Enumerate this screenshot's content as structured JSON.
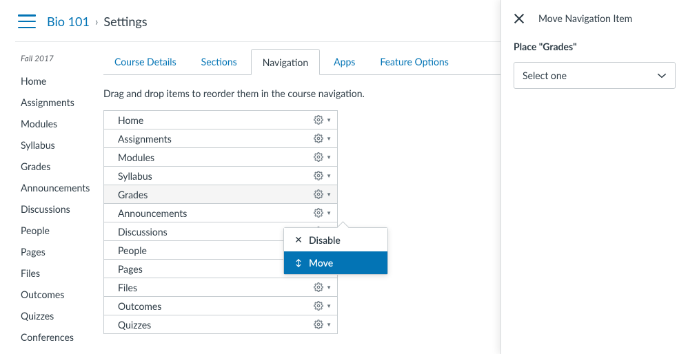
{
  "breadcrumb": {
    "course": "Bio 101",
    "current": "Settings"
  },
  "sidebar": {
    "term": "Fall 2017",
    "items": [
      {
        "label": "Home"
      },
      {
        "label": "Assignments"
      },
      {
        "label": "Modules"
      },
      {
        "label": "Syllabus"
      },
      {
        "label": "Grades"
      },
      {
        "label": "Announcements"
      },
      {
        "label": "Discussions"
      },
      {
        "label": "People"
      },
      {
        "label": "Pages"
      },
      {
        "label": "Files"
      },
      {
        "label": "Outcomes"
      },
      {
        "label": "Quizzes"
      },
      {
        "label": "Conferences"
      }
    ]
  },
  "tabs": [
    {
      "label": "Course Details",
      "active": false
    },
    {
      "label": "Sections",
      "active": false
    },
    {
      "label": "Navigation",
      "active": true
    },
    {
      "label": "Apps",
      "active": false
    },
    {
      "label": "Feature Options",
      "active": false
    }
  ],
  "instruction": "Drag and drop items to reorder them in the course navigation.",
  "nav_items": [
    {
      "label": "Home"
    },
    {
      "label": "Assignments"
    },
    {
      "label": "Modules"
    },
    {
      "label": "Syllabus"
    },
    {
      "label": "Grades",
      "highlight": true
    },
    {
      "label": "Announcements"
    },
    {
      "label": "Discussions"
    },
    {
      "label": "People"
    },
    {
      "label": "Pages"
    },
    {
      "label": "Files"
    },
    {
      "label": "Outcomes"
    },
    {
      "label": "Quizzes"
    }
  ],
  "dropdown": {
    "disable": "Disable",
    "move": "Move"
  },
  "panel": {
    "title": "Move Navigation Item",
    "label": "Place \"Grades\"",
    "select": "Select one"
  }
}
